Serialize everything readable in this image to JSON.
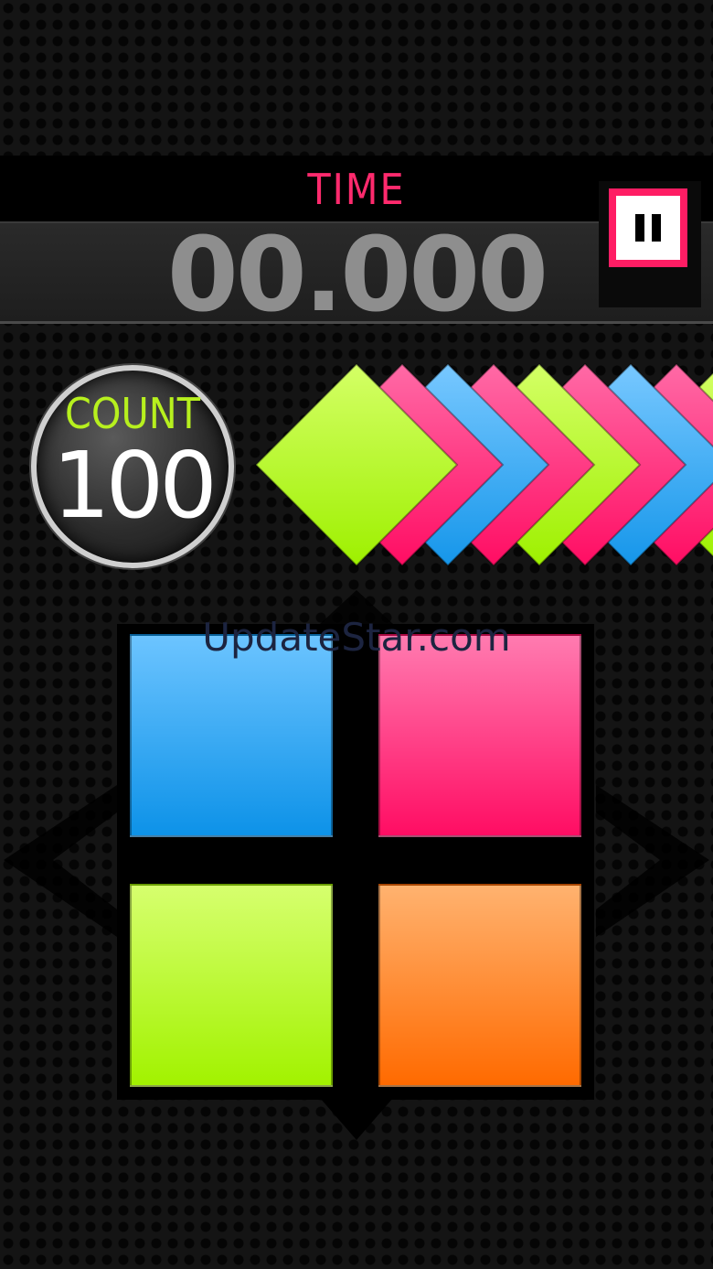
{
  "header": {
    "time_label": "TIME",
    "timer_value": "00.000"
  },
  "count": {
    "label": "COUNT",
    "value": "100"
  },
  "queue_colors": [
    "green",
    "pink",
    "blue",
    "pink",
    "green",
    "pink",
    "blue",
    "pink",
    "green"
  ],
  "pads": [
    {
      "color": "blue",
      "hex": "#0d92e8"
    },
    {
      "color": "pink",
      "hex": "#ff0d63"
    },
    {
      "color": "green",
      "hex": "#a2f200"
    },
    {
      "color": "orange",
      "hex": "#ff6a00"
    }
  ],
  "colors": {
    "accent_pink": "#ff1d64",
    "count_green": "#b7f01e",
    "timer_grey": "#8e8e8e"
  },
  "watermark": "UpdateStar.com",
  "icons": {
    "pause": "pause-icon",
    "left_arrow": "chevron-left-icon",
    "right_arrow": "chevron-right-icon"
  }
}
